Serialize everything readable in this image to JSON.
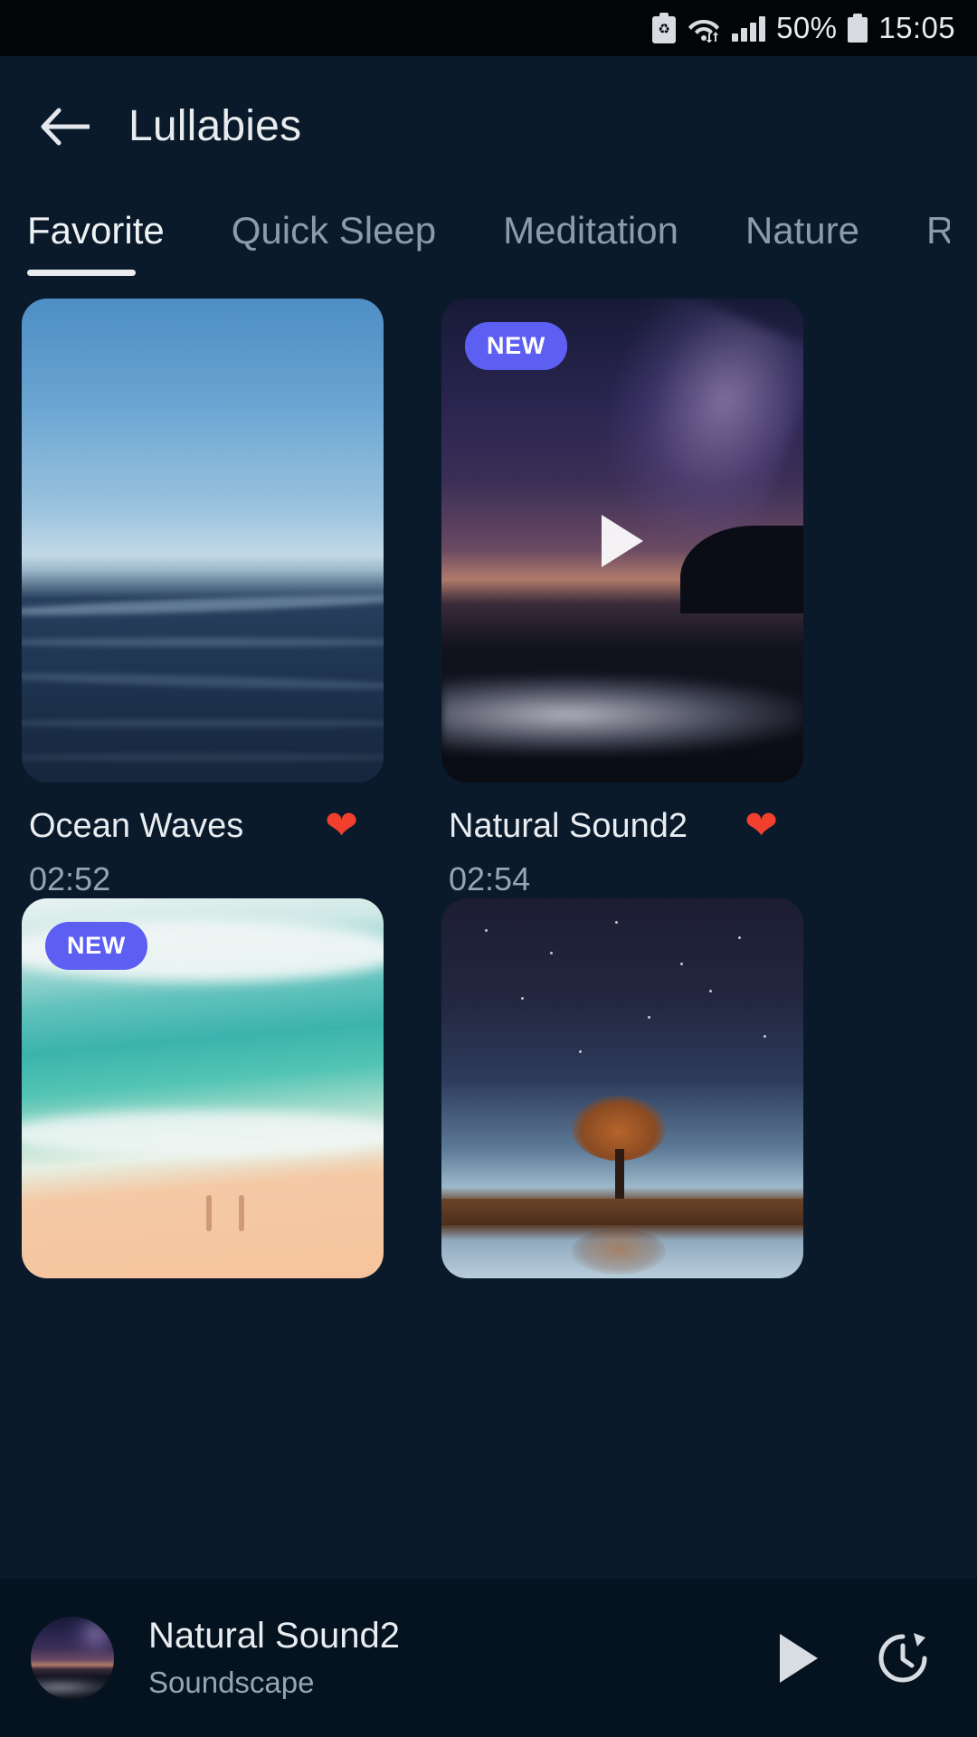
{
  "status_bar": {
    "icons": [
      "power-saving-battery-icon",
      "wifi-icon",
      "signal-icon",
      "battery-icon"
    ],
    "battery_percent": "50%",
    "time": "15:05"
  },
  "app_bar": {
    "back_icon": "arrow-left-icon",
    "title": "Lullabies"
  },
  "tabs": [
    {
      "label": "Favorite",
      "active": true
    },
    {
      "label": "Quick Sleep",
      "active": false
    },
    {
      "label": "Meditation",
      "active": false
    },
    {
      "label": "Nature",
      "active": false
    },
    {
      "label": "R",
      "active": false
    }
  ],
  "tracks": [
    {
      "title": "Ocean Waves",
      "duration": "02:52",
      "favorite": true,
      "heart_icon": "heart-filled-icon",
      "badge": "",
      "playing": false,
      "artwork": "ocean-waves-artwork"
    },
    {
      "title": "Natural Sound2",
      "duration": "02:54",
      "favorite": true,
      "heart_icon": "heart-filled-icon",
      "badge": "NEW",
      "playing": true,
      "artwork": "night-sky-beach-artwork"
    },
    {
      "title": "",
      "duration": "",
      "favorite": false,
      "heart_icon": "",
      "badge": "NEW",
      "playing": false,
      "artwork": "aerial-beach-artwork"
    },
    {
      "title": "",
      "duration": "",
      "favorite": false,
      "heart_icon": "",
      "badge": "",
      "playing": false,
      "artwork": "lone-tree-reflection-artwork"
    }
  ],
  "mini_player": {
    "title": "Natural Sound2",
    "subtitle": "Soundscape",
    "play_icon": "play-icon",
    "timer_icon": "sleep-timer-icon",
    "thumbnail": "night-sky-beach-artwork"
  },
  "colors": {
    "background": "#0a1a2b",
    "status_bar_bg": "#020508",
    "player_bg": "#05121f",
    "accent_badge": "#5d5ff3",
    "heart": "#f1402e",
    "text_primary": "#e9edf1",
    "text_secondary": "#97a4b2",
    "tab_inactive": "#8e9aa8"
  }
}
